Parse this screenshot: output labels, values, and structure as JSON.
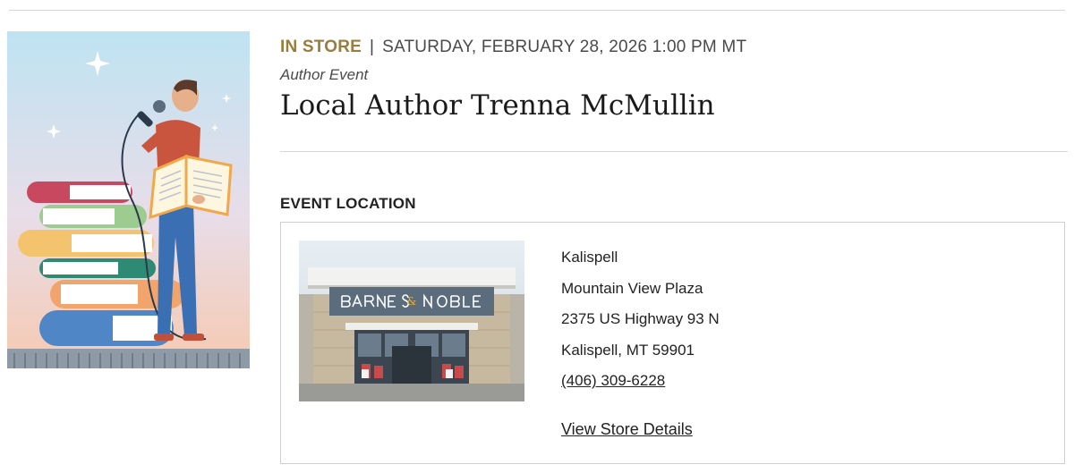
{
  "event": {
    "store_tag": "IN STORE",
    "separator": "|",
    "datetime": "SATURDAY, FEBRUARY 28, 2026 1:00 PM MT",
    "category": "Author Event",
    "title": "Local Author Trenna McMullin"
  },
  "location": {
    "heading": "EVENT LOCATION",
    "photo_sign": "BARNES & NOBLE",
    "name": "Kalispell",
    "plaza": "Mountain View Plaza",
    "street": "2375 US Highway 93 N",
    "city_state_zip": "Kalispell, MT 59901",
    "phone": "(406) 309-6228",
    "details_link": "View Store Details"
  },
  "colors": {
    "store_tag": "#9a7d3c",
    "divider": "#d6d6d6"
  }
}
